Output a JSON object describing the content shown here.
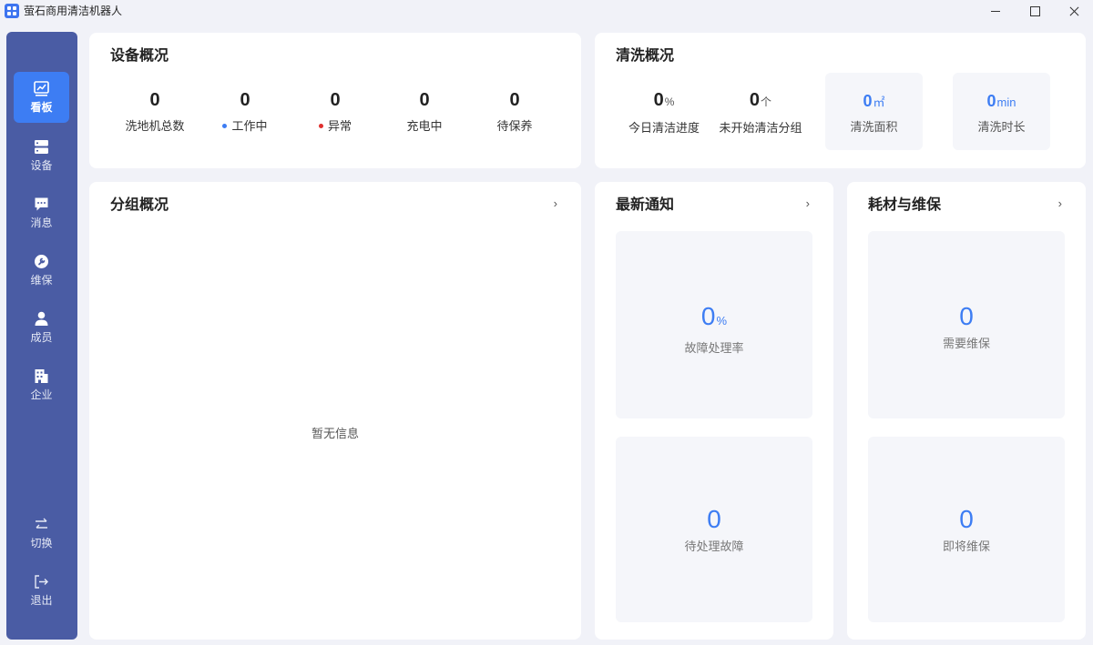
{
  "window": {
    "title": "萤石商用清洁机器人"
  },
  "sidebar": {
    "items": [
      {
        "label": "看板",
        "icon": "chart-icon",
        "active": true
      },
      {
        "label": "设备",
        "icon": "device-icon",
        "active": false
      },
      {
        "label": "消息",
        "icon": "message-icon",
        "active": false
      },
      {
        "label": "维保",
        "icon": "wrench-icon",
        "active": false
      },
      {
        "label": "成员",
        "icon": "user-icon",
        "active": false
      },
      {
        "label": "企业",
        "icon": "building-icon",
        "active": false
      }
    ],
    "bottom": [
      {
        "label": "切换",
        "icon": "switch-icon"
      },
      {
        "label": "退出",
        "icon": "logout-icon"
      }
    ]
  },
  "device_overview": {
    "title": "设备概况",
    "stats": [
      {
        "value": "0",
        "label": "洗地机总数"
      },
      {
        "value": "0",
        "label": "工作中",
        "dot_color": "#3d7df3"
      },
      {
        "value": "0",
        "label": "异常",
        "dot_color": "#e0302e"
      },
      {
        "value": "0",
        "label": "充电中"
      },
      {
        "value": "0",
        "label": "待保养"
      }
    ]
  },
  "cleaning_overview": {
    "title": "清洗概况",
    "progress": {
      "value": "0",
      "unit": "%",
      "label": "今日清洁进度"
    },
    "not_started": {
      "value": "0",
      "unit": "个",
      "label": "未开始清洁分组"
    },
    "area": {
      "value": "0",
      "unit": "㎡",
      "label": "清洗面积"
    },
    "duration": {
      "value": "0",
      "unit": "min",
      "label": "清洗时长"
    }
  },
  "group_overview": {
    "title": "分组概况",
    "arrow": "›",
    "empty_text": "暂无信息"
  },
  "latest_notice": {
    "title": "最新通知",
    "arrow": "›",
    "fault_rate": {
      "value": "0",
      "unit": "%",
      "label": "故障处理率"
    },
    "pending_faults": {
      "value": "0",
      "label": "待处理故障"
    }
  },
  "maintenance": {
    "title": "耗材与维保",
    "arrow": "›",
    "need": {
      "value": "0",
      "label": "需要维保"
    },
    "upcoming": {
      "value": "0",
      "label": "即将维保"
    }
  }
}
